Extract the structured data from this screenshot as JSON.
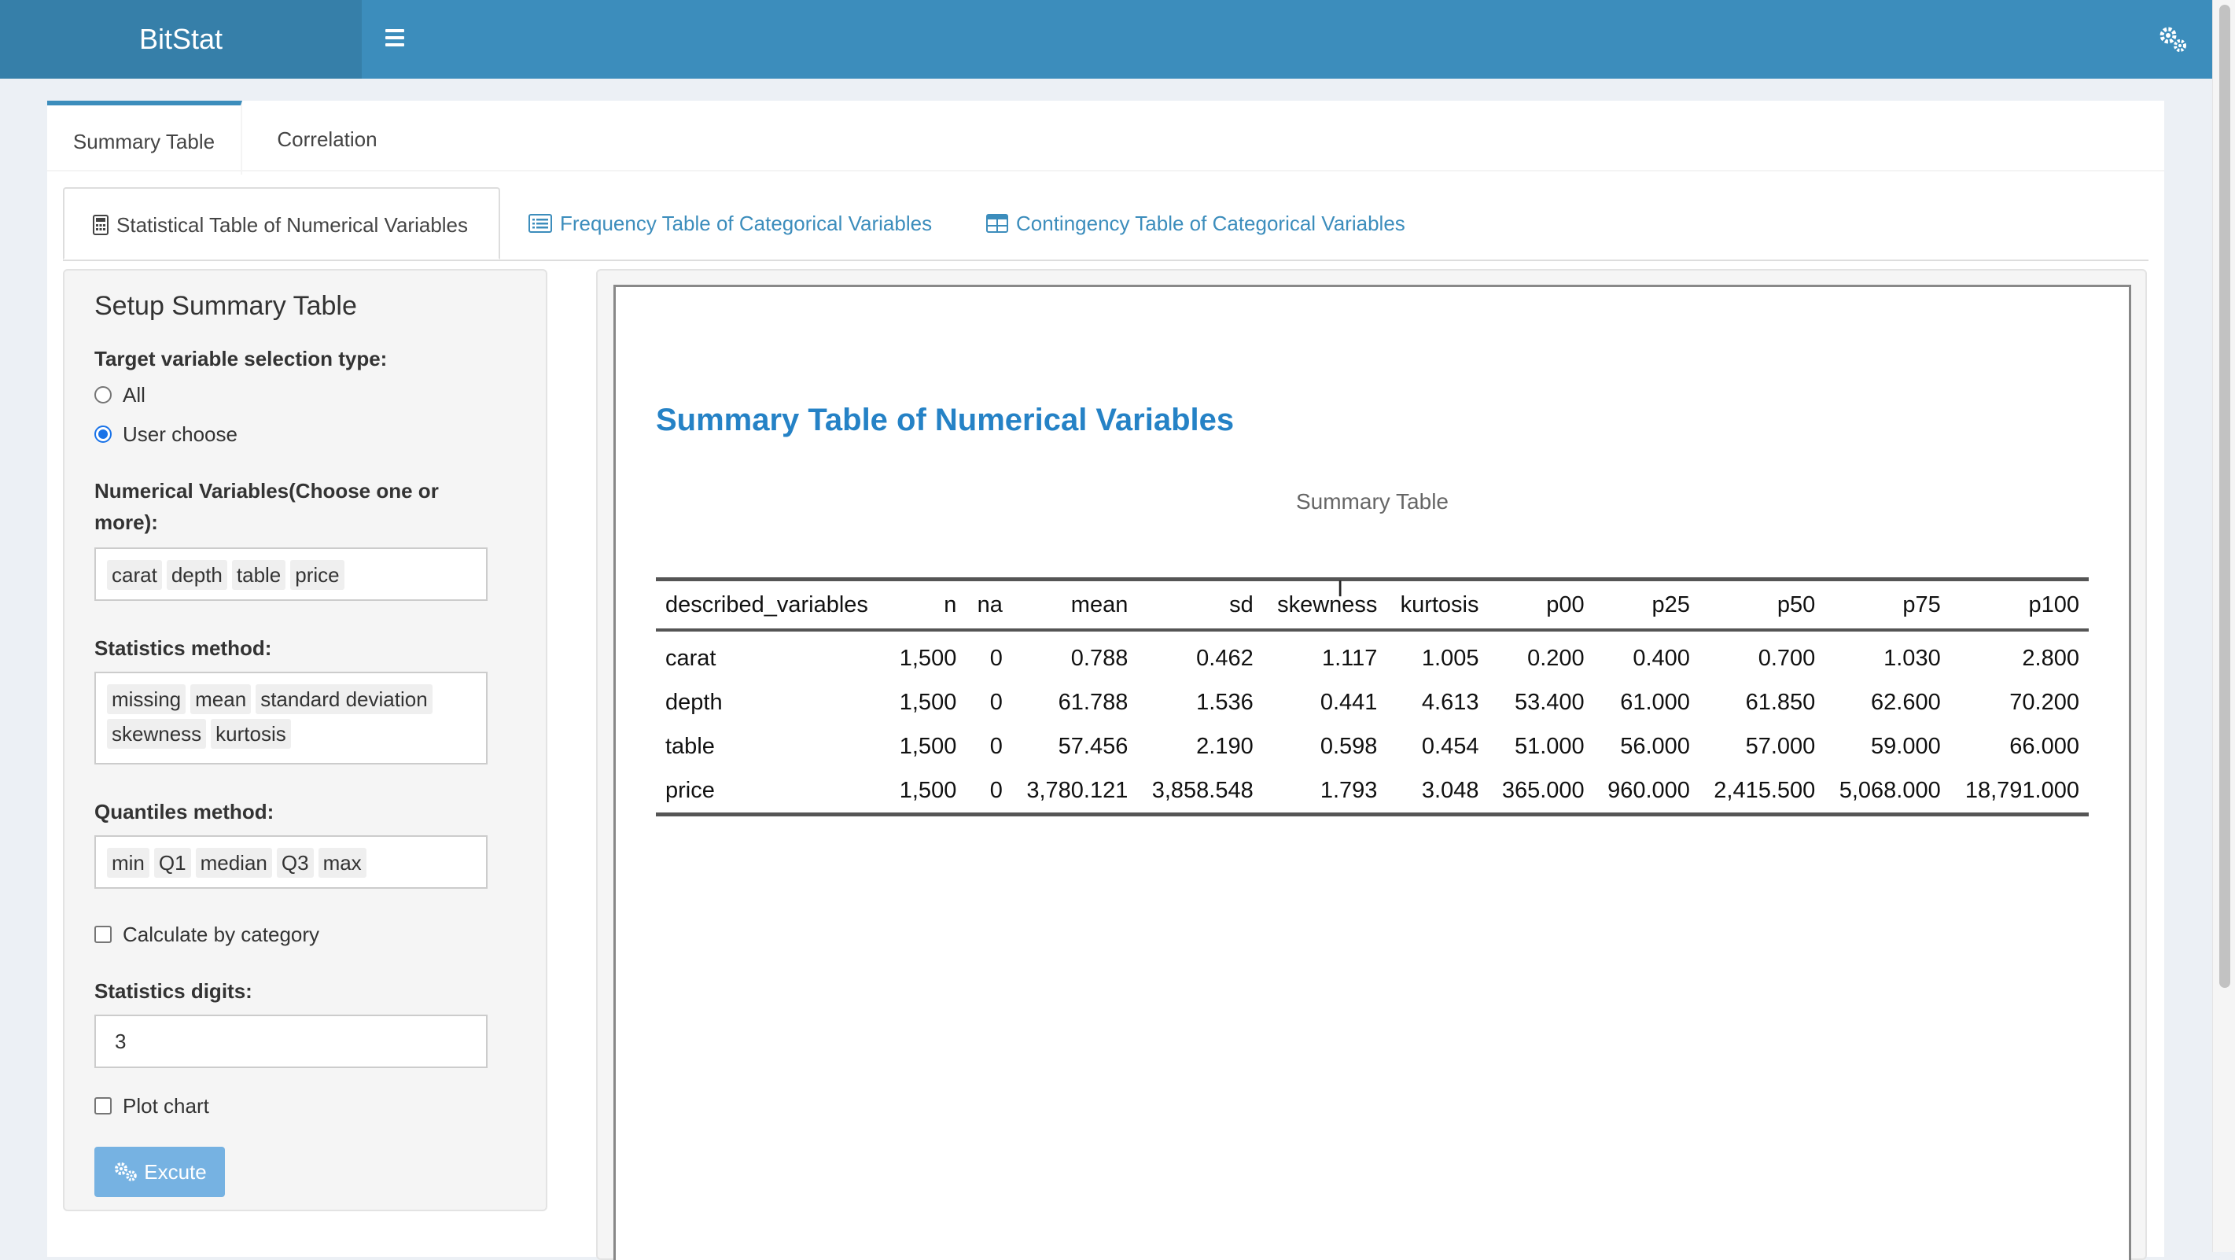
{
  "app": {
    "title": "BitStat"
  },
  "outer_tabs": [
    "Summary Table",
    "Correlation"
  ],
  "inner_tabs": [
    "Statistical Table of Numerical Variables",
    "Frequency Table of Categorical Variables",
    "Contingency Table of Categorical Variables"
  ],
  "setup": {
    "title": "Setup Summary Table",
    "selection_type_label": "Target variable selection type:",
    "option_all": "All",
    "option_user_choose": "User choose",
    "selected_option": "User choose",
    "numerical_label_line1": "Numerical Variables(Choose one or",
    "numerical_label_line2": "more):",
    "numerical_selected": [
      "carat",
      "depth",
      "table",
      "price"
    ],
    "statistics_label": "Statistics method:",
    "statistics_selected": [
      "missing",
      "mean",
      "standard deviation",
      "skewness",
      "kurtosis"
    ],
    "quantiles_label": "Quantiles method:",
    "quantiles_selected": [
      "min",
      "Q1",
      "median",
      "Q3",
      "max"
    ],
    "by_category_label": "Calculate by category",
    "by_category_checked": false,
    "digits_label": "Statistics digits:",
    "digits_value": "3",
    "plot_chart_label": "Plot chart",
    "plot_chart_checked": false,
    "execute_label": "Excute"
  },
  "report": {
    "title": "Summary Table of Numerical Variables",
    "caption": "Summary Table",
    "columns": [
      "described_variables",
      "n",
      "na",
      "mean",
      "sd",
      "skewness",
      "kurtosis",
      "p00",
      "p25",
      "p50",
      "p75",
      "p100"
    ],
    "rows": [
      [
        "carat",
        "1,500",
        "0",
        "0.788",
        "0.462",
        "1.117",
        "1.005",
        "0.200",
        "0.400",
        "0.700",
        "1.030",
        "2.800"
      ],
      [
        "depth",
        "1,500",
        "0",
        "61.788",
        "1.536",
        "0.441",
        "4.613",
        "53.400",
        "61.000",
        "61.850",
        "62.600",
        "70.200"
      ],
      [
        "table",
        "1,500",
        "0",
        "57.456",
        "2.190",
        "0.598",
        "0.454",
        "51.000",
        "56.000",
        "57.000",
        "59.000",
        "66.000"
      ],
      [
        "price",
        "1,500",
        "0",
        "3,780.121",
        "3,858.548",
        "1.793",
        "3.048",
        "365.000",
        "960.000",
        "2,415.500",
        "5,068.000",
        "18,791.000"
      ]
    ]
  },
  "colors": {
    "header": "#3c8dbc",
    "logo_bg": "#367fa9",
    "accent": "#2582c6",
    "execute_button": "#76b2e2"
  },
  "icons": [
    "hamburger-icon",
    "gears-icon",
    "calculator-icon",
    "list-icon",
    "table-icon"
  ]
}
